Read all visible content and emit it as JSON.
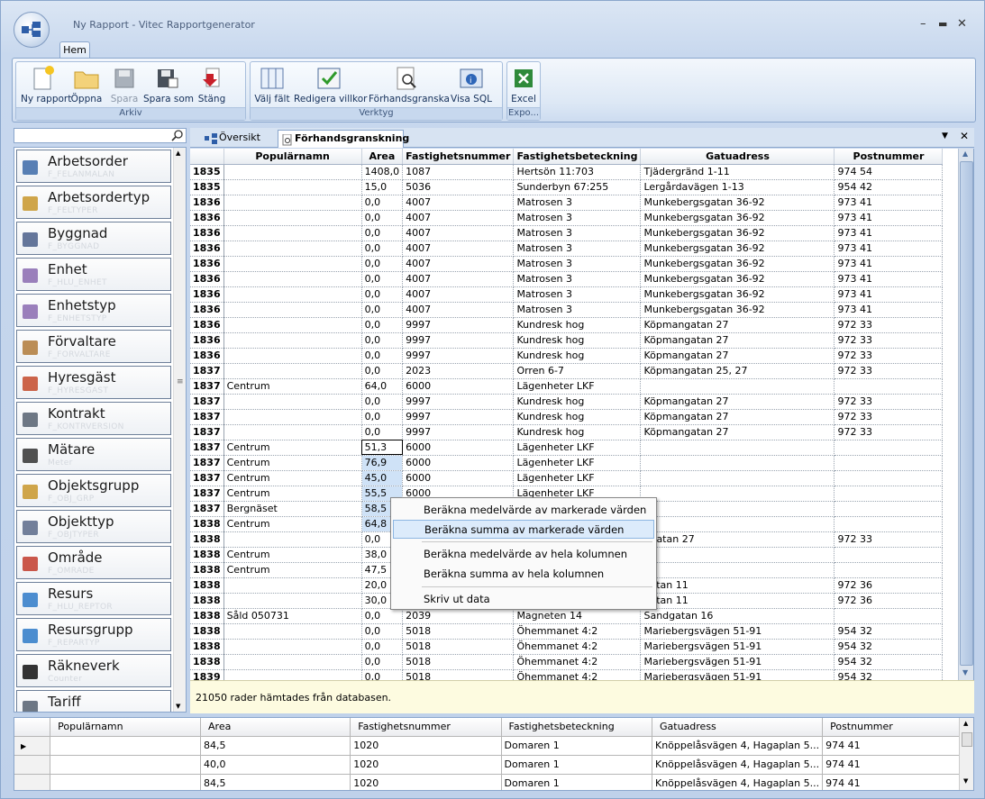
{
  "window": {
    "title": "Ny Rapport - Vitec Rapportgenerator",
    "tab": "Hem"
  },
  "ribbon": {
    "groups": [
      {
        "label": "Arkiv"
      },
      {
        "label": "Verktyg"
      },
      {
        "label": "Expo..."
      }
    ],
    "buttons": [
      {
        "label": "Ny rapport"
      },
      {
        "label": "Öppna"
      },
      {
        "label": "Spara"
      },
      {
        "label": "Spara som"
      },
      {
        "label": "Stäng"
      },
      {
        "label": "Välj fält"
      },
      {
        "label": "Redigera villkor"
      },
      {
        "label": "Förhandsgranska"
      },
      {
        "label": "Visa SQL"
      },
      {
        "label": "Excel"
      }
    ]
  },
  "sidebar": {
    "items": [
      {
        "name": "Arbetsorder",
        "sub": "F_FELANMALAN"
      },
      {
        "name": "Arbetsordertyp",
        "sub": "F_FELTYPER"
      },
      {
        "name": "Byggnad",
        "sub": "F_BYGGNAD"
      },
      {
        "name": "Enhet",
        "sub": "F_HLU_ENHET"
      },
      {
        "name": "Enhetstyp",
        "sub": "F_ENHETSTYP"
      },
      {
        "name": "Förvaltare",
        "sub": "F_FORVALTARE"
      },
      {
        "name": "Hyresgäst",
        "sub": "F_HYRESGAST"
      },
      {
        "name": "Kontrakt",
        "sub": "F_KONTRVERSION"
      },
      {
        "name": "Mätare",
        "sub": "Meter"
      },
      {
        "name": "Objektsgrupp",
        "sub": "F_OBJ_GRP"
      },
      {
        "name": "Objekttyp",
        "sub": "F_OBJTYPER"
      },
      {
        "name": "Område",
        "sub": "F_OMRADE"
      },
      {
        "name": "Resurs",
        "sub": "F_HLU_REPTOR"
      },
      {
        "name": "Resursgrupp",
        "sub": "F_REPARTYP"
      },
      {
        "name": "Räkneverk",
        "sub": "Counter"
      },
      {
        "name": "Tariff",
        "sub": ""
      }
    ]
  },
  "tabs": [
    {
      "label": "Översikt"
    },
    {
      "label": "Förhandsgranskning"
    }
  ],
  "grid": {
    "columns": [
      "",
      "Populärnamn",
      "Area",
      "Fastighetsnummer",
      "Fastighetsbeteckning",
      "Gatuadress",
      "Postnummer"
    ],
    "rows": [
      [
        "1835",
        "",
        "1408,0",
        "1087",
        "Hertsön 11:703",
        "Tjädergränd 1-11",
        "974 54"
      ],
      [
        "1835",
        "",
        "15,0",
        "5036",
        "Sunderbyn 67:255",
        "Lergårdavägen 1-13",
        "954 42"
      ],
      [
        "1836",
        "",
        "0,0",
        "4007",
        "Matrosen 3",
        "Munkebergsgatan 36-92",
        "973 41"
      ],
      [
        "1836",
        "",
        "0,0",
        "4007",
        "Matrosen 3",
        "Munkebergsgatan 36-92",
        "973 41"
      ],
      [
        "1836",
        "",
        "0,0",
        "4007",
        "Matrosen 3",
        "Munkebergsgatan 36-92",
        "973 41"
      ],
      [
        "1836",
        "",
        "0,0",
        "4007",
        "Matrosen 3",
        "Munkebergsgatan 36-92",
        "973 41"
      ],
      [
        "1836",
        "",
        "0,0",
        "4007",
        "Matrosen 3",
        "Munkebergsgatan 36-92",
        "973 41"
      ],
      [
        "1836",
        "",
        "0,0",
        "4007",
        "Matrosen 3",
        "Munkebergsgatan 36-92",
        "973 41"
      ],
      [
        "1836",
        "",
        "0,0",
        "4007",
        "Matrosen 3",
        "Munkebergsgatan 36-92",
        "973 41"
      ],
      [
        "1836",
        "",
        "0,0",
        "4007",
        "Matrosen 3",
        "Munkebergsgatan 36-92",
        "973 41"
      ],
      [
        "1836",
        "",
        "0,0",
        "9997",
        "Kundresk hog",
        "Köpmangatan 27",
        "972 33"
      ],
      [
        "1836",
        "",
        "0,0",
        "9997",
        "Kundresk hog",
        "Köpmangatan 27",
        "972 33"
      ],
      [
        "1836",
        "",
        "0,0",
        "9997",
        "Kundresk hog",
        "Köpmangatan 27",
        "972 33"
      ],
      [
        "1837",
        "",
        "0,0",
        "2023",
        "Orren 6-7",
        "Köpmangatan 25, 27",
        "972 33"
      ],
      [
        "1837",
        "Centrum",
        "64,0",
        "6000",
        "Lägenheter LKF",
        "",
        ""
      ],
      [
        "1837",
        "",
        "0,0",
        "9997",
        "Kundresk hog",
        "Köpmangatan 27",
        "972 33"
      ],
      [
        "1837",
        "",
        "0,0",
        "9997",
        "Kundresk hog",
        "Köpmangatan 27",
        "972 33"
      ],
      [
        "1837",
        "",
        "0,0",
        "9997",
        "Kundresk hog",
        "Köpmangatan 27",
        "972 33"
      ],
      [
        "1837",
        "Centrum",
        "51,3",
        "6000",
        "Lägenheter LKF",
        "",
        ""
      ],
      [
        "1837",
        "Centrum",
        "76,9",
        "6000",
        "Lägenheter LKF",
        "",
        ""
      ],
      [
        "1837",
        "Centrum",
        "45,0",
        "6000",
        "Lägenheter LKF",
        "",
        ""
      ],
      [
        "1837",
        "Centrum",
        "55,5",
        "6000",
        "Lägenheter LKF",
        "",
        ""
      ],
      [
        "1837",
        "Bergnäset",
        "58,5",
        "",
        "",
        "",
        ""
      ],
      [
        "1838",
        "Centrum",
        "64,8",
        "",
        "",
        "",
        ""
      ],
      [
        "1838",
        "",
        "0,0",
        "",
        "",
        "ngatan 27",
        "972 33"
      ],
      [
        "1838",
        "Centrum",
        "38,0",
        "",
        "",
        "",
        ""
      ],
      [
        "1838",
        "Centrum",
        "47,5",
        "",
        "",
        "",
        ""
      ],
      [
        "1838",
        "",
        "20,0",
        "",
        "",
        "gatan 11",
        "972 36"
      ],
      [
        "1838",
        "",
        "30,0",
        "",
        "",
        "gatan 11",
        "972 36"
      ],
      [
        "1838",
        "Såld 050731",
        "0,0",
        "2039",
        "Magneten 14",
        "Sandgatan 16",
        ""
      ],
      [
        "1838",
        "",
        "0,0",
        "5018",
        "Öhemmanet 4:2",
        "Mariebergsvägen 51-91",
        "954 32"
      ],
      [
        "1838",
        "",
        "0,0",
        "5018",
        "Öhemmanet 4:2",
        "Mariebergsvägen 51-91",
        "954 32"
      ],
      [
        "1838",
        "",
        "0,0",
        "5018",
        "Öhemmanet 4:2",
        "Mariebergsvägen 51-91",
        "954 32"
      ],
      [
        "1839",
        "",
        "0,0",
        "5018",
        "Öhemmanet 4:2",
        "Mariebergsvägen 51-91",
        "954 32"
      ]
    ]
  },
  "context_menu": {
    "items": [
      "Beräkna medelvärde av markerade värden",
      "Beräkna summa av markerade värden",
      "Beräkna medelvärde av hela kolumnen",
      "Beräkna summa av hela kolumnen",
      "Skriv ut data"
    ]
  },
  "status": "21050 rader hämtades från databasen.",
  "bottom": {
    "columns": [
      "Populärnamn",
      "Area",
      "Fastighetsnummer",
      "Fastighetsbeteckning",
      "Gatuadress",
      "Postnummer"
    ],
    "rows": [
      [
        "",
        "84,5",
        "1020",
        "Domaren 1",
        "Knöppelåsvägen 4, Hagaplan 5...",
        "974 41"
      ],
      [
        "",
        "40,0",
        "1020",
        "Domaren 1",
        "Knöppelåsvägen 4, Hagaplan 5...",
        "974 41"
      ],
      [
        "",
        "84,5",
        "1020",
        "Domaren 1",
        "Knöppelåsvägen 4, Hagaplan 5...",
        "974 41"
      ]
    ]
  }
}
